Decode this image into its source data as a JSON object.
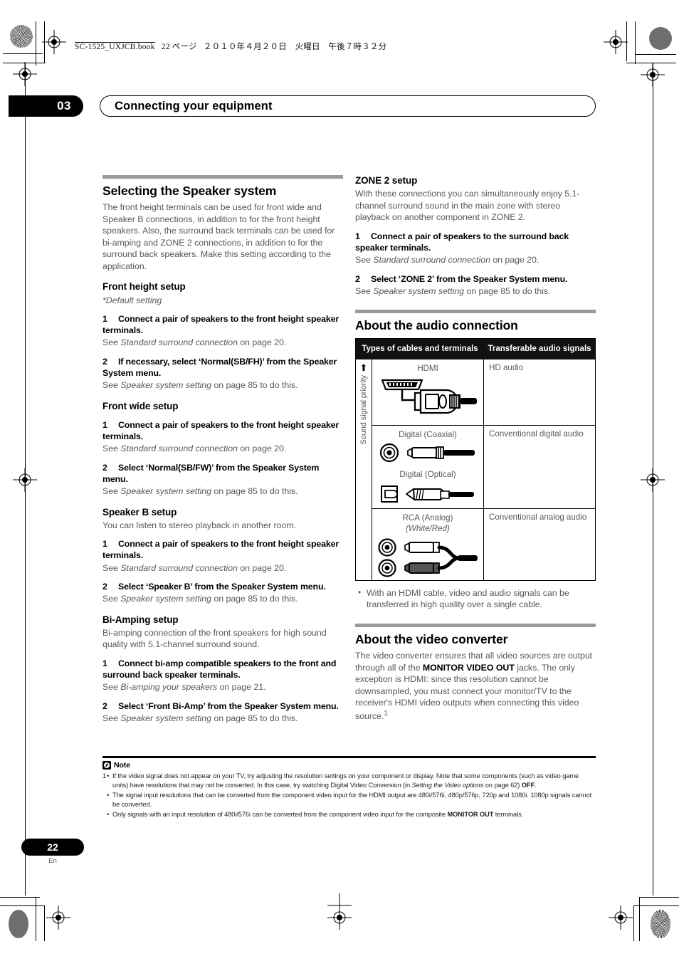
{
  "printheader": {
    "filename": "SC-1525_UXJCB.book",
    "page_label": "22 ページ",
    "date": "２０１０年４月２０日　火曜日　午後７時３２分"
  },
  "chapter": {
    "number": "03",
    "title": "Connecting your equipment"
  },
  "left_column": {
    "section_title": "Selecting the Speaker system",
    "intro": "The front height terminals can be used for front wide and Speaker B connections, in addition to for the front height speakers. Also, the surround back terminals can be used for bi-amping and ZONE 2 connections, in addition to for the surround back speakers. Make this setting according to the application.",
    "blocks": [
      {
        "heading": "Front height setup",
        "note": "*Default setting",
        "steps": [
          {
            "n": "1",
            "text": "Connect a pair of speakers to the front height speaker terminals.",
            "see_pre": "See ",
            "see_italic": "Standard surround connection",
            "see_post": " on page 20."
          },
          {
            "n": "2",
            "text": "If necessary, select ‘Normal(SB/FH)’ from the Speaker System menu.",
            "see_pre": "See ",
            "see_italic": "Speaker system setting",
            "see_post": " on page 85 to do this."
          }
        ]
      },
      {
        "heading": "Front wide setup",
        "steps": [
          {
            "n": "1",
            "text": "Connect a pair of speakers to the front height speaker terminals.",
            "see_pre": "See ",
            "see_italic": "Standard surround connection",
            "see_post": " on page 20."
          },
          {
            "n": "2",
            "text": "Select ‘Normal(SB/FW)’ from the Speaker System menu.",
            "see_pre": "See ",
            "see_italic": "Speaker system setting",
            "see_post": " on page 85 to do this."
          }
        ]
      },
      {
        "heading": "Speaker B setup",
        "intro": "You can listen to stereo playback in another room.",
        "steps": [
          {
            "n": "1",
            "text": "Connect a pair of speakers to the front height speaker terminals.",
            "see_pre": "See ",
            "see_italic": "Standard surround connection",
            "see_post": " on page 20."
          },
          {
            "n": "2",
            "text": "Select ‘Speaker B’ from the Speaker System menu.",
            "see_pre": "See ",
            "see_italic": "Speaker system setting",
            "see_post": " on page 85 to do this."
          }
        ]
      },
      {
        "heading": "Bi-Amping setup",
        "intro": "Bi-amping connection of the front speakers for high sound quality with 5.1-channel surround sound.",
        "steps": [
          {
            "n": "1",
            "text": "Connect bi-amp compatible speakers to the front and surround back speaker terminals.",
            "see_pre": "See ",
            "see_italic": "Bi-amping your speakers",
            "see_post": " on page 21."
          },
          {
            "n": "2",
            "text": "Select ‘Front Bi-Amp’ from the Speaker System menu.",
            "see_pre": "See ",
            "see_italic": "Speaker system setting",
            "see_post": " on page 85 to do this."
          }
        ]
      }
    ]
  },
  "right_column": {
    "zone2": {
      "heading": "ZONE 2 setup",
      "intro": "With these connections you can simultaneously enjoy 5.1-channel surround sound in the main zone with stereo playback on another component in ZONE 2.",
      "steps": [
        {
          "n": "1",
          "text": "Connect a pair of speakers to the surround back speaker terminals.",
          "see_pre": "See ",
          "see_italic": "Standard surround connection",
          "see_post": " on page 20."
        },
        {
          "n": "2",
          "text": "Select ‘ZONE 2’ from the Speaker System menu.",
          "see_pre": "See ",
          "see_italic": "Speaker system setting",
          "see_post": " on page 85 to do this."
        }
      ]
    },
    "audio_section": {
      "title": "About the audio connection",
      "table": {
        "priority_label": "Sound signal priority",
        "priority_arrow": "up-arrow",
        "headers": [
          "Types of cables and terminals",
          "Transferable audio signals"
        ],
        "rows": [
          {
            "cables": [
              {
                "name": "HDMI",
                "sub": "",
                "icon": "hdmi-connector"
              }
            ],
            "signal": "HD audio"
          },
          {
            "cables": [
              {
                "name": "Digital (Coaxial)",
                "sub": "",
                "icon": "coaxial-connector"
              },
              {
                "name": "Digital (Optical)",
                "sub": "",
                "icon": "optical-connector"
              }
            ],
            "signal": "Conventional digital audio"
          },
          {
            "cables": [
              {
                "name": "RCA (Analog)",
                "sub": "(White/Red)",
                "icon": "rca-connector"
              }
            ],
            "signal": "Conventional analog audio"
          }
        ]
      },
      "bullets": [
        "With an HDMI cable, video and audio signals can be transferred in high quality over a single cable."
      ]
    },
    "video_section": {
      "title": "About the video converter",
      "para_1": "The video converter ensures that all video sources are output through all of the ",
      "para_bold": "MONITOR VIDEO OUT",
      "para_2": " jacks. The only exception is HDMI: since this resolution cannot be downsampled, you must connect your monitor/TV to the receiver's HDMI video outputs when connecting this video source.",
      "footnote_ref": "1"
    }
  },
  "note": {
    "label": "Note",
    "icon": "note-icon",
    "items": [
      {
        "marker": "1",
        "bullet": "•",
        "part_1": "If the video signal does not appear on your TV, try adjusting the resolution settings on your component or display. Note that some components (such as video game units) have resolutions that may not be converted. In this case, try switching Digital Video Conversion (in ",
        "italic": "Setting the Video options",
        "part_2": " on page 62) ",
        "bold": "OFF",
        "part_3": "."
      },
      {
        "marker": "",
        "bullet": "•",
        "part_1": "The signal input resolutions that can be converted from the component video input for the HDMI output are 480i/576i, 480p/576p, 720p and 1080i. 1080p signals cannot be converted.",
        "italic": "",
        "part_2": "",
        "bold": "",
        "part_3": ""
      },
      {
        "marker": "",
        "bullet": "•",
        "part_1": "Only signals with an input resolution of 480i/576i can be converted from the component video input for the composite ",
        "italic": "",
        "part_2": "",
        "bold": "MONITOR OUT",
        "part_3": " terminals."
      }
    ]
  },
  "footer": {
    "page_number": "22",
    "language": "En"
  }
}
